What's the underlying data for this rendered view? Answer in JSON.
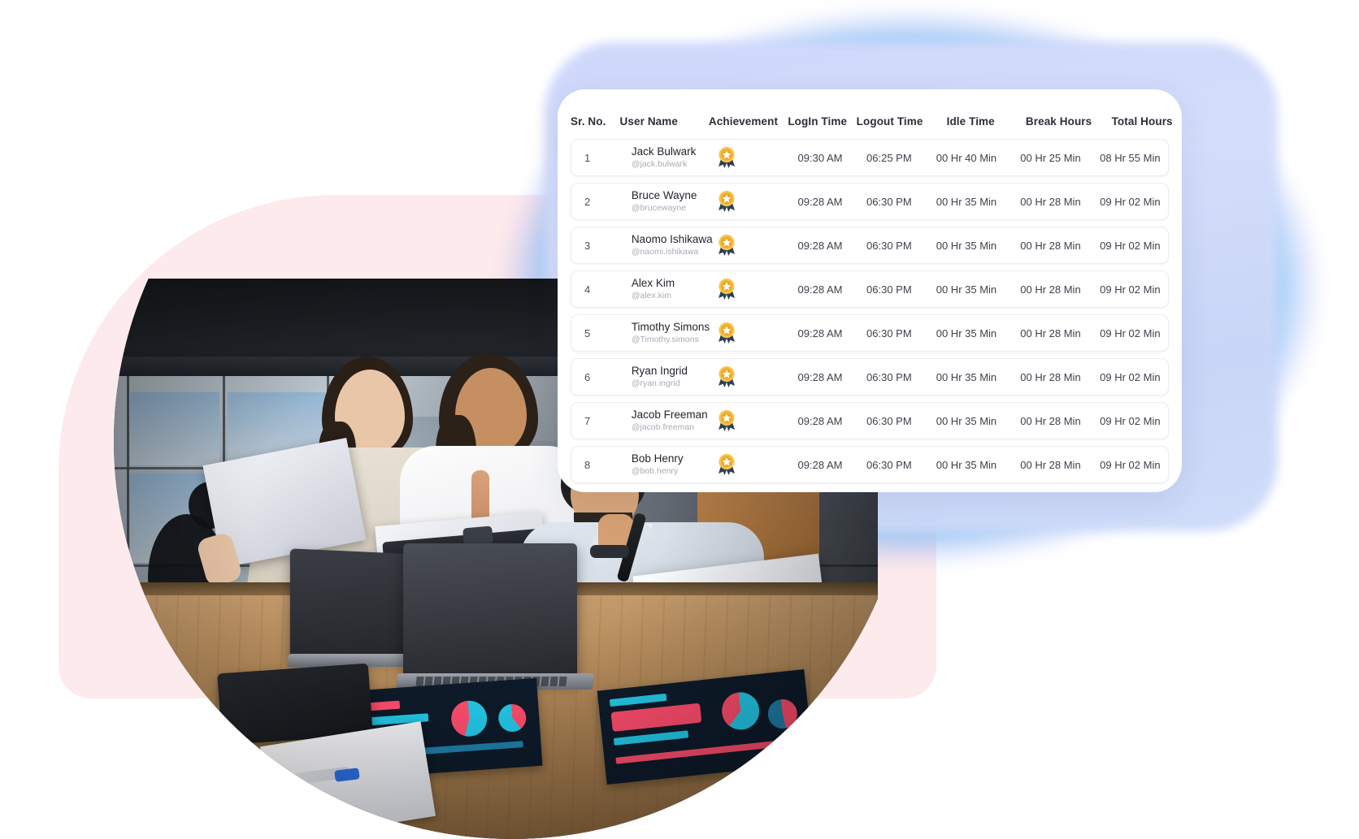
{
  "dashboard": {
    "columns": [
      {
        "key": "sr",
        "label": "Sr. No."
      },
      {
        "key": "user",
        "label": "User Name"
      },
      {
        "key": "ach",
        "label": "Achievement"
      },
      {
        "key": "login",
        "label": "LogIn Time"
      },
      {
        "key": "logout",
        "label": "Logout Time"
      },
      {
        "key": "idle",
        "label": "Idle Time"
      },
      {
        "key": "break",
        "label": "Break Hours"
      },
      {
        "key": "total",
        "label": "Total Hours"
      }
    ],
    "rows": [
      {
        "sr": "1",
        "name": "Jack Bulwark",
        "handle": "@jack.bulwark",
        "achievement": "medal-icon",
        "login": "09:30 AM",
        "logout": "06:25 PM",
        "idle": "00 Hr 40 Min",
        "break": "00 Hr 25 Min",
        "total": "08 Hr 55 Min"
      },
      {
        "sr": "2",
        "name": "Bruce Wayne",
        "handle": "@brucewayne",
        "achievement": "medal-icon",
        "login": "09:28 AM",
        "logout": "06:30 PM",
        "idle": "00 Hr 35 Min",
        "break": "00 Hr 28 Min",
        "total": "09 Hr 02 Min"
      },
      {
        "sr": "3",
        "name": "Naomo Ishikawa",
        "handle": "@naomi.ishikawa",
        "achievement": "medal-icon",
        "login": "09:28 AM",
        "logout": "06:30 PM",
        "idle": "00 Hr 35 Min",
        "break": "00 Hr 28 Min",
        "total": "09 Hr 02 Min"
      },
      {
        "sr": "4",
        "name": "Alex Kim",
        "handle": "@alex.kim",
        "achievement": "medal-icon",
        "login": "09:28 AM",
        "logout": "06:30 PM",
        "idle": "00 Hr 35 Min",
        "break": "00 Hr 28 Min",
        "total": "09 Hr 02 Min"
      },
      {
        "sr": "5",
        "name": "Timothy Simons",
        "handle": "@Timothy.simons",
        "achievement": "medal-icon",
        "login": "09:28 AM",
        "logout": "06:30 PM",
        "idle": "00 Hr 35 Min",
        "break": "00 Hr 28 Min",
        "total": "09 Hr 02 Min"
      },
      {
        "sr": "6",
        "name": "Ryan Ingrid",
        "handle": "@ryan.ingrid",
        "achievement": "medal-icon",
        "login": "09:28 AM",
        "logout": "06:30 PM",
        "idle": "00 Hr 35 Min",
        "break": "00 Hr 28 Min",
        "total": "09 Hr 02 Min"
      },
      {
        "sr": "7",
        "name": "Jacob Freeman",
        "handle": "@jacob.freeman",
        "achievement": "medal-icon",
        "login": "09:28 AM",
        "logout": "06:30 PM",
        "idle": "00 Hr 35 Min",
        "break": "00 Hr 28 Min",
        "total": "09 Hr 02 Min"
      },
      {
        "sr": "8",
        "name": "Bob Henry",
        "handle": "@bob.henry",
        "achievement": "medal-icon",
        "login": "09:28 AM",
        "logout": "06:30 PM",
        "idle": "00 Hr 35 Min",
        "break": "00 Hr 28 Min",
        "total": "09 Hr 02 Min"
      }
    ]
  },
  "decor": {
    "pink_blob_color": "#fdeaec",
    "glow_colors": [
      "#8ce6f5",
      "#9696fa",
      "#afb9fa"
    ],
    "card_background": "#ffffff",
    "medal_gold": "#f5b731",
    "medal_ribbon": "#2e4057"
  },
  "photo": {
    "scene": "three colleagues reviewing printed reports at an office table with laptops",
    "alt": "office-team-photo"
  }
}
